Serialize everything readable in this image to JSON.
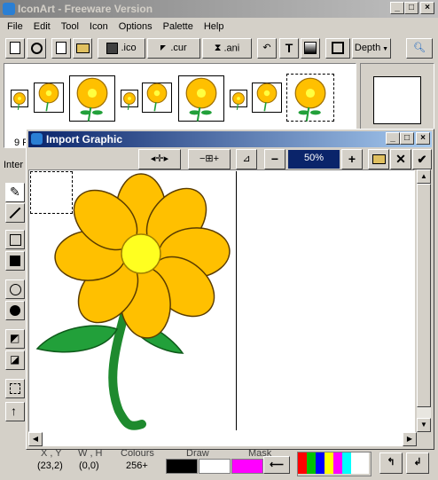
{
  "app": {
    "title": "IconArt - Freeware Version",
    "menu": [
      "File",
      "Edit",
      "Tool",
      "Icon",
      "Options",
      "Palette",
      "Help"
    ]
  },
  "toolbar": {
    "ico_label": ".ico",
    "cur_label": ".cur",
    "ani_label": ".ani",
    "text_glyph": "T",
    "depth_label": "Depth"
  },
  "left_panel": {
    "partial_label": "9 F",
    "section_label": "Inter"
  },
  "dialog": {
    "title": "Import Graphic",
    "zoom_value": "50%",
    "minus_glyph": "−",
    "plus_glyph": "+"
  },
  "status": {
    "xy_header": "X , Y",
    "xy_value": "(23,2)",
    "wh_header": "W , H",
    "wh_value": "(0,0)",
    "colours_header": "Colours",
    "colours_value": "256+",
    "draw_header": "Draw",
    "mask_header": "Mask"
  },
  "colors": {
    "titlebar_active": "#0a246a",
    "petal": "#ffc000",
    "leaf": "#22a03a",
    "mask_color": "#ff00ff",
    "draw_color": "#000000"
  },
  "palette": [
    "#ff0000",
    "#00c000",
    "#0000ff",
    "#ffff00",
    "#ff00ff",
    "#00ffff",
    "#ffffff"
  ],
  "icons": [
    "new-icon",
    "open-zoom-icon",
    "new-doc-icon",
    "open-folder-icon",
    "save-icon",
    "pointer-icon",
    "hourglass-icon",
    "undo-icon",
    "text-icon",
    "gradient-icon",
    "frame-icon",
    "zoom-glass-icon",
    "pencil-icon",
    "line-icon",
    "rect-outline-icon",
    "rect-fill-icon",
    "ellipse-outline-icon",
    "ellipse-fill-icon",
    "fill-bucket-icon",
    "eraser-icon",
    "select-icon",
    "arrow-up-icon"
  ]
}
